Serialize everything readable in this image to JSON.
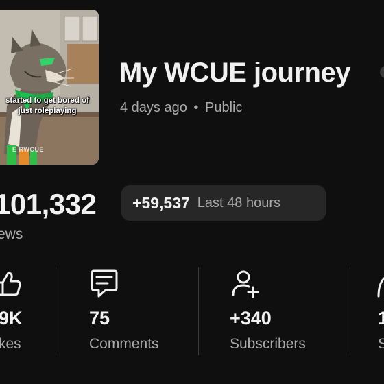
{
  "video": {
    "title": "My WCUE journey",
    "age": "4 days ago",
    "separator": "•",
    "visibility": "Public",
    "thumbnail": {
      "caption_line1": "started to get bored of",
      "caption_line2": "just roleplaying",
      "watermark": "E   RWCUE"
    }
  },
  "views": {
    "count": "101,332",
    "label": "ews"
  },
  "recent": {
    "delta": "+59,537",
    "period": "Last 48 hours"
  },
  "stats": [
    {
      "icon": "thumbs-up-icon",
      "value": "9K",
      "label": "kes"
    },
    {
      "icon": "comment-icon",
      "value": "75",
      "label": "Comments"
    },
    {
      "icon": "add-person-icon",
      "value": "+340",
      "label": "Subscribers"
    },
    {
      "icon": "share-icon",
      "value": "1",
      "label": "S"
    }
  ],
  "colors": {
    "background": "#0f0f0f",
    "primary_text": "#f1f1f1",
    "secondary_text": "#aaaaaa",
    "pill_bg": "#272727"
  }
}
